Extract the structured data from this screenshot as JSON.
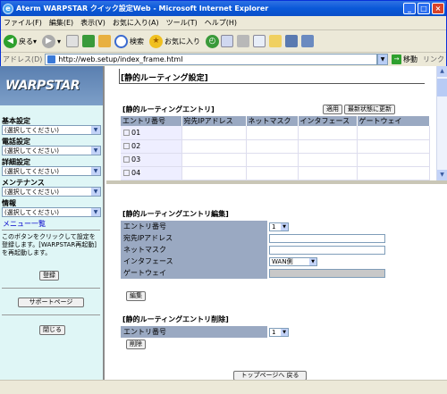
{
  "window": {
    "title": "Aterm WARPSTAR クイック設定Web - Microsoft Internet Explorer"
  },
  "menu": [
    "ファイル(F)",
    "編集(E)",
    "表示(V)",
    "お気に入り(A)",
    "ツール(T)",
    "ヘルプ(H)"
  ],
  "toolbar": {
    "back": "戻る",
    "search": "検索",
    "favorites": "お気に入り"
  },
  "address": {
    "label": "アドレス(D)",
    "url": "http://web.setup/index_frame.html",
    "go": "移動",
    "links": "リンク"
  },
  "sidebar": {
    "logo": "WARPSTAR",
    "sections": [
      {
        "heading": "基本設定",
        "select": "(選択してください)"
      },
      {
        "heading": "電話設定",
        "select": "(選択してください)"
      },
      {
        "heading": "詳細設定",
        "select": "(選択してください)"
      },
      {
        "heading": "メンテナンス",
        "select": "(選択してください)"
      },
      {
        "heading": "情報",
        "select": "(選択してください)"
      }
    ],
    "menu_list": "メニュー一覧",
    "message": "このボタンをクリックして設定を登録します。[WARPSTAR再起動]を再起動します。",
    "register": "登録",
    "support": "サポートページ",
    "close": "閉じる"
  },
  "top": {
    "page_title": "[静的ルーティング設定]",
    "entry_heading": "[静的ルーティングエントリ]",
    "apply": "適用",
    "refresh": "最新状態に更新",
    "columns": [
      "エントリ番号",
      "宛先IPアドレス",
      "ネットマスク",
      "インタフェース",
      "ゲートウェイ"
    ],
    "rows": [
      "01",
      "02",
      "03",
      "04"
    ]
  },
  "bottom": {
    "edit_heading": "[静的ルーティングエントリ編集]",
    "edit_fields": [
      {
        "label": "エントリ番号",
        "value": "1"
      },
      {
        "label": "宛先IPアドレス",
        "value": ""
      },
      {
        "label": "ネットマスク",
        "value": ""
      },
      {
        "label": "インタフェース",
        "value": "WAN側"
      },
      {
        "label": "ゲートウェイ",
        "value": ""
      }
    ],
    "edit_button": "編集",
    "delete_heading": "[静的ルーティングエントリ削除]",
    "delete_label": "エントリ番号",
    "delete_value": "1",
    "delete_button": "削除",
    "top_button": "トップページへ 戻る"
  }
}
